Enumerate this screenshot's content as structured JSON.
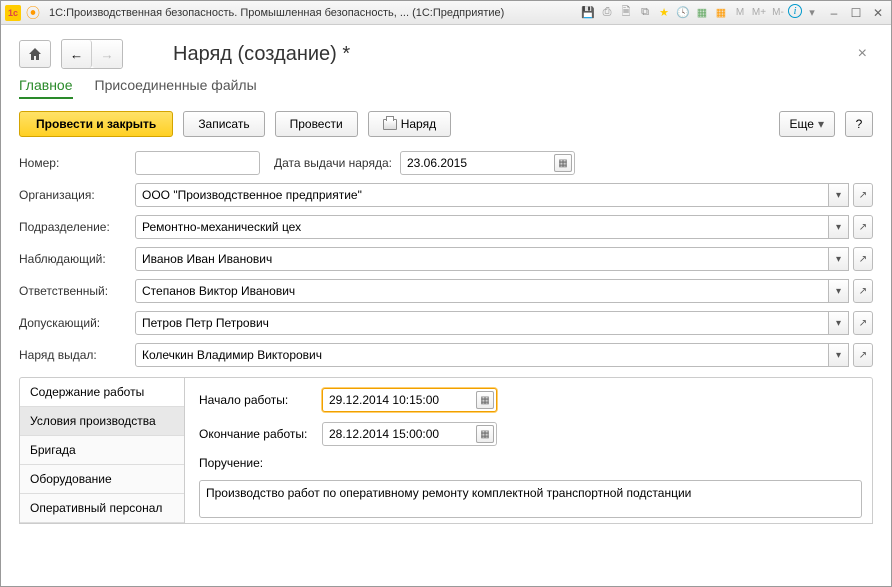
{
  "window": {
    "title": "1С:Производственная безопасность. Промышленная безопасность, ... (1С:Предприятие)"
  },
  "page": {
    "title": "Наряд (создание) *"
  },
  "navTabs": {
    "main": "Главное",
    "attached": "Присоединенные файлы"
  },
  "actions": {
    "postClose": "Провести и закрыть",
    "save": "Записать",
    "post": "Провести",
    "print": "Наряд",
    "more": "Еще",
    "help": "?"
  },
  "labels": {
    "number": "Номер:",
    "issueDate": "Дата выдачи наряда:",
    "org": "Организация:",
    "dept": "Подразделение:",
    "observer": "Наблюдающий:",
    "responsible": "Ответственный:",
    "admitter": "Допускающий:",
    "issuer": "Наряд выдал:"
  },
  "fields": {
    "number": "",
    "issueDate": "23.06.2015",
    "org": "ООО \"Производственное предприятие\"",
    "dept": "Ремонтно-механический цех",
    "observer": "Иванов Иван Иванович",
    "responsible": "Степанов Виктор Иванович",
    "admitter": "Петров Петр Петрович",
    "issuer": "Колечкин Владимир Викторович"
  },
  "sideTabs": {
    "content": "Содержание работы",
    "conditions": "Условия производства",
    "brigade": "Бригада",
    "equipment": "Оборудование",
    "personnel": "Оперативный персонал"
  },
  "work": {
    "startLabel": "Начало работы:",
    "startValue": "29.12.2014 10:15:00",
    "endLabel": "Окончание работы:",
    "endValue": "28.12.2014 15:00:00",
    "assignmentLabel": "Поручение:",
    "assignmentValue": "Производство работ по оперативному ремонту комплектной транспортной подстанции"
  }
}
